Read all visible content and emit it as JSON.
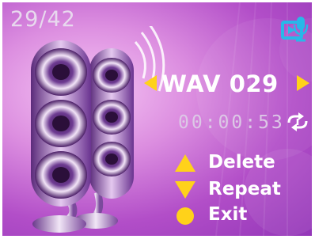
{
  "player": {
    "track_counter": "29/42",
    "track_title": "WAV 029",
    "elapsed_time": "00:00:53"
  },
  "menu": {
    "items": [
      {
        "label": "Delete",
        "icon": "triangle-up-icon"
      },
      {
        "label": "Repeat",
        "icon": "triangle-down-icon"
      },
      {
        "label": "Exit",
        "icon": "circle-icon"
      }
    ]
  },
  "icons": {
    "mode": "playlist-mic-icon",
    "repeat": "repeat-one-icon",
    "prev": "arrow-left-icon",
    "next": "arrow-right-icon"
  },
  "colors": {
    "background": "#b24ec8",
    "accent_yellow": "#ffd21a",
    "mode_icon": "#28b8e8",
    "text": "#ffffff"
  }
}
